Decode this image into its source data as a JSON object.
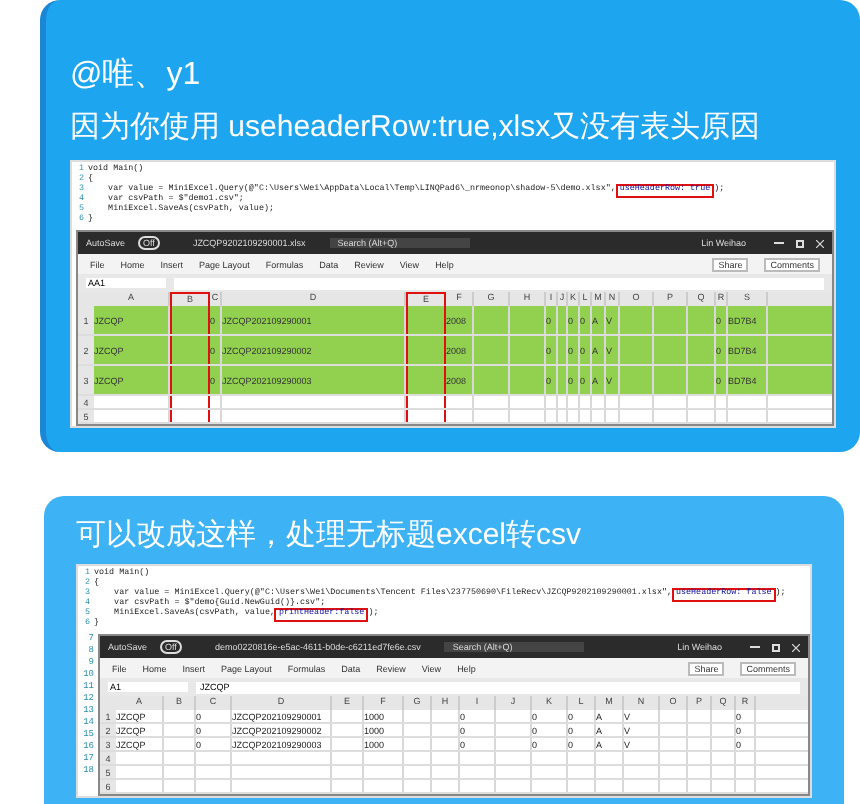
{
  "messages": [
    {
      "mention": "@唯、y1",
      "text": "因为你使用 useheaderRow:true,xlsx又没有表头原因",
      "screenshot": {
        "code_lines": [
          {
            "number": "1",
            "parts": [
              {
                "text": "void Main()",
                "boxed": false
              }
            ]
          },
          {
            "number": "2",
            "parts": [
              {
                "text": "{",
                "boxed": false
              }
            ]
          },
          {
            "number": "3",
            "parts": [
              {
                "text": "    var value = MiniExcel.Query(@\"C:\\Users\\Wei\\AppData\\Local\\Temp\\LINQPad6\\_nrmeonop\\shadow-5\\demo.xlsx\",",
                "boxed": false
              },
              {
                "text": "useHeaderRow: true",
                "boxed": true
              },
              {
                "text": ");",
                "boxed": false
              }
            ]
          },
          {
            "number": "4",
            "parts": [
              {
                "text": "    var csvPath = $\"demo1.csv\";",
                "boxed": false
              }
            ]
          },
          {
            "number": "5",
            "parts": [
              {
                "text": "    MiniExcel.SaveAs(csvPath, value);",
                "boxed": false
              }
            ]
          },
          {
            "number": "6",
            "parts": [
              {
                "text": "}",
                "boxed": false
              }
            ]
          }
        ],
        "excel": {
          "autosave": "AutoSave",
          "toggle": "Off",
          "file": "JZCQP9202109290001.xlsx",
          "search": "Search (Alt+Q)",
          "user": "Lin Weihao",
          "menu": [
            "File",
            "Home",
            "Insert",
            "Page Layout",
            "Formulas",
            "Data",
            "Review",
            "View",
            "Help"
          ],
          "share": "Share",
          "comments": "Comments",
          "name_box": "AA1",
          "columns": [
            {
              "label": "A",
              "boxed": false
            },
            {
              "label": "B",
              "boxed": true
            },
            {
              "label": "C",
              "boxed": false
            },
            {
              "label": "D",
              "boxed": false
            },
            {
              "label": "E",
              "boxed": true
            },
            {
              "label": "F",
              "boxed": false
            },
            {
              "label": "G",
              "boxed": false
            },
            {
              "label": "H",
              "boxed": false
            },
            {
              "label": "I",
              "boxed": false
            },
            {
              "label": "J",
              "boxed": false
            },
            {
              "label": "K",
              "boxed": false
            },
            {
              "label": "L",
              "boxed": false
            },
            {
              "label": "M",
              "boxed": false
            },
            {
              "label": "N",
              "boxed": false
            },
            {
              "label": "O",
              "boxed": false
            },
            {
              "label": "P",
              "boxed": false
            },
            {
              "label": "Q",
              "boxed": false
            },
            {
              "label": "R",
              "boxed": false
            },
            {
              "label": "S",
              "boxed": false
            }
          ],
          "rows": [
            {
              "number": "1",
              "selected": true,
              "cells": [
                "JZCQP",
                "",
                "0",
                "JZCQP202109290001",
                "",
                "2008",
                "",
                "",
                "0",
                "",
                "0",
                "0",
                "A",
                "V",
                "",
                "",
                "",
                "0",
                "BD7B4"
              ]
            },
            {
              "number": "2",
              "selected": true,
              "cells": [
                "JZCQP",
                "",
                "0",
                "JZCQP202109290002",
                "",
                "2008",
                "",
                "",
                "0",
                "",
                "0",
                "0",
                "A",
                "V",
                "",
                "",
                "",
                "0",
                "BD7B4"
              ]
            },
            {
              "number": "3",
              "selected": true,
              "cells": [
                "JZCQP",
                "",
                "0",
                "JZCQP202109290003",
                "",
                "2008",
                "",
                "",
                "0",
                "",
                "0",
                "0",
                "A",
                "V",
                "",
                "",
                "",
                "0",
                "BD7B4"
              ]
            },
            {
              "number": "4",
              "selected": false,
              "cells": []
            },
            {
              "number": "5",
              "selected": false,
              "cells": []
            }
          ]
        }
      }
    },
    {
      "text": "可以改成这样，处理无标题excel转csv",
      "screenshot": {
        "code_lines": [
          {
            "number": "1",
            "parts": [
              {
                "text": "void Main()",
                "boxed": false
              }
            ]
          },
          {
            "number": "2",
            "parts": [
              {
                "text": "{",
                "boxed": false
              }
            ]
          },
          {
            "number": "3",
            "parts": [
              {
                "text": "    var value = MiniExcel.Query(@\"C:\\Users\\Wei\\Documents\\Tencent Files\\237750690\\FileRecv\\JZCQP9202109290001.xlsx\",",
                "boxed": false
              },
              {
                "text": "useHeaderRow: false",
                "boxed": true
              },
              {
                "text": ");",
                "boxed": false
              }
            ]
          },
          {
            "number": "4",
            "parts": [
              {
                "text": "    var csvPath = $\"demo{Guid.NewGuid()}.csv\";",
                "boxed": false
              }
            ]
          },
          {
            "number": "5",
            "parts": [
              {
                "text": "    MiniExcel.SaveAs(csvPath, value,",
                "boxed": false
              },
              {
                "text": "printHeader:false",
                "boxed": true
              },
              {
                "text": ");",
                "boxed": false
              }
            ]
          },
          {
            "number": "6",
            "parts": [
              {
                "text": "}",
                "boxed": false
              }
            ]
          }
        ],
        "side_numbers": [
          "7",
          "8",
          "9",
          "10",
          "11",
          "12",
          "13",
          "14",
          "15",
          "16",
          "17",
          "18"
        ],
        "excel": {
          "autosave": "AutoSave",
          "toggle": "Off",
          "file": "demo0220816e-e5ac-4611-b0de-c6211ed7fe6e.csv",
          "search": "Search (Alt+Q)",
          "user": "Lin Weihao",
          "menu": [
            "File",
            "Home",
            "Insert",
            "Page Layout",
            "Formulas",
            "Data",
            "Review",
            "View",
            "Help"
          ],
          "share": "Share",
          "comments": "Comments",
          "name_box": "A1",
          "formula": "JZCQP",
          "columns": [
            {
              "label": "A",
              "boxed": false
            },
            {
              "label": "B",
              "boxed": false
            },
            {
              "label": "C",
              "boxed": false
            },
            {
              "label": "D",
              "boxed": false
            },
            {
              "label": "E",
              "boxed": false
            },
            {
              "label": "F",
              "boxed": false
            },
            {
              "label": "G",
              "boxed": false
            },
            {
              "label": "H",
              "boxed": false
            },
            {
              "label": "I",
              "boxed": false
            },
            {
              "label": "J",
              "boxed": false
            },
            {
              "label": "K",
              "boxed": false
            },
            {
              "label": "L",
              "boxed": false
            },
            {
              "label": "M",
              "boxed": false
            },
            {
              "label": "N",
              "boxed": false
            },
            {
              "label": "O",
              "boxed": false
            },
            {
              "label": "P",
              "boxed": false
            },
            {
              "label": "Q",
              "boxed": false
            },
            {
              "label": "R",
              "boxed": false
            }
          ],
          "rows": [
            {
              "number": "1",
              "selected": false,
              "cells": [
                "JZCQP",
                "",
                "0",
                "JZCQP202109290001",
                "",
                "1000",
                "",
                "",
                "0",
                "",
                "0",
                "0",
                "A",
                "V",
                "",
                "",
                "",
                "0"
              ]
            },
            {
              "number": "2",
              "selected": false,
              "cells": [
                "JZCQP",
                "",
                "0",
                "JZCQP202109290002",
                "",
                "1000",
                "",
                "",
                "0",
                "",
                "0",
                "0",
                "A",
                "V",
                "",
                "",
                "",
                "0"
              ]
            },
            {
              "number": "3",
              "selected": false,
              "cells": [
                "JZCQP",
                "",
                "0",
                "JZCQP202109290003",
                "",
                "1000",
                "",
                "",
                "0",
                "",
                "0",
                "0",
                "A",
                "V",
                "",
                "",
                "",
                "0"
              ]
            },
            {
              "number": "4",
              "selected": false,
              "cells": []
            },
            {
              "number": "5",
              "selected": false,
              "cells": []
            },
            {
              "number": "6",
              "selected": false,
              "cells": []
            }
          ]
        }
      }
    }
  ]
}
